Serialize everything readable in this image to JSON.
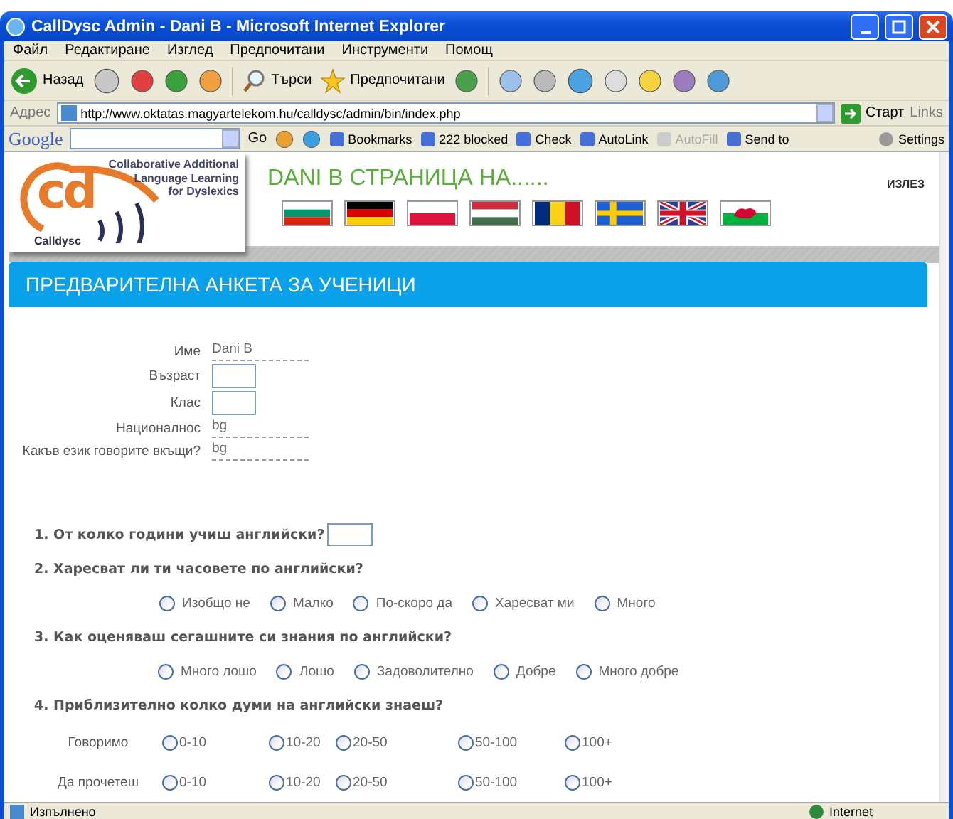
{
  "window": {
    "title": "CallDysc Admin - Dani B - Microsoft Internet Explorer"
  },
  "menu": [
    "Файл",
    "Редактиране",
    "Изглед",
    "Предпочитани",
    "Инструменти",
    "Помощ"
  ],
  "toolbar": {
    "back": "Назад",
    "search": "Търси",
    "favorites": "Предпочитани"
  },
  "address": {
    "label": "Адрес",
    "url": "http://www.oktatas.magyartelekom.hu/calldysc/admin/bin/index.php",
    "go": "Старт",
    "links": "Links"
  },
  "google_bar": {
    "brand": "Google",
    "go": "Go",
    "items": [
      {
        "label": "Bookmarks",
        "disabled": false
      },
      {
        "label": "222 blocked",
        "disabled": false
      },
      {
        "label": "Check",
        "disabled": false
      },
      {
        "label": "AutoLink",
        "disabled": false
      },
      {
        "label": "AutoFill",
        "disabled": true
      },
      {
        "label": "Send to",
        "disabled": false
      }
    ],
    "settings": "Settings"
  },
  "page": {
    "logo": {
      "mark": "cd",
      "lines": [
        "Collaborative Additional",
        "Language Learning",
        "for Dyslexics"
      ],
      "caption": "Calldysc"
    },
    "heading": "DANI В СТРАНИЦА НА......",
    "logout": "ИЗЛЕЗ",
    "flags": [
      {
        "kind": "bg"
      },
      {
        "kind": "de"
      },
      {
        "kind": "pl"
      },
      {
        "kind": "hu"
      },
      {
        "kind": "ro"
      },
      {
        "kind": "se"
      },
      {
        "kind": "gb"
      },
      {
        "kind": "wales"
      }
    ],
    "section_title": "ПРЕДВАРИТЕЛНА АНКЕТА ЗА УЧЕНИЦИ",
    "profile": [
      {
        "label": "Име",
        "kind": "text",
        "value": "Dani B"
      },
      {
        "label": "Възраст",
        "kind": "input"
      },
      {
        "label": "Клас",
        "kind": "input"
      },
      {
        "label": "Националнос",
        "kind": "text",
        "value": "bg"
      },
      {
        "label": "Какъв език говорите вкъщи?",
        "kind": "text",
        "value": "bg"
      }
    ],
    "questions": [
      {
        "kind": "input",
        "text": "1. От колко години учиш английски?"
      },
      {
        "kind": "choices",
        "text": "2. Харесват ли ти часовете по английски?",
        "options": [
          {
            "label": "Изобщо не",
            "selected": false
          },
          {
            "label": "Малко",
            "selected": false
          },
          {
            "label": "По-скоро да",
            "selected": false
          },
          {
            "label": "Харесват ми",
            "selected": false
          },
          {
            "label": "Много",
            "selected": false
          }
        ]
      },
      {
        "kind": "choices",
        "text": "3. Как оценяваш сегашните си знания по английски?",
        "options": [
          {
            "label": "Много лошо",
            "selected": false
          },
          {
            "label": "Лошо",
            "selected": false
          },
          {
            "label": "Задоволително",
            "selected": false
          },
          {
            "label": "Добре",
            "selected": false
          },
          {
            "label": "Много добре",
            "selected": false
          }
        ]
      },
      {
        "kind": "grid",
        "text": "4. Приблизително колко думи на английски знаеш?",
        "rows": [
          {
            "label": "Говоримо",
            "options": [
              {
                "label": "0-10",
                "selected": false
              },
              {
                "label": "10-20",
                "selected": false
              },
              {
                "label": "20-50",
                "selected": false
              },
              {
                "label": "50-100",
                "selected": false
              },
              {
                "label": "100+",
                "selected": false
              }
            ]
          },
          {
            "label": "Да прочетеш",
            "options": [
              {
                "label": "0-10",
                "selected": false
              },
              {
                "label": "10-20",
                "selected": false
              },
              {
                "label": "20-50",
                "selected": false
              },
              {
                "label": "50-100",
                "selected": false
              },
              {
                "label": "100+",
                "selected": false
              }
            ]
          }
        ]
      }
    ]
  },
  "status_bar": {
    "text": "Изпълнено",
    "zone": "Internet"
  }
}
